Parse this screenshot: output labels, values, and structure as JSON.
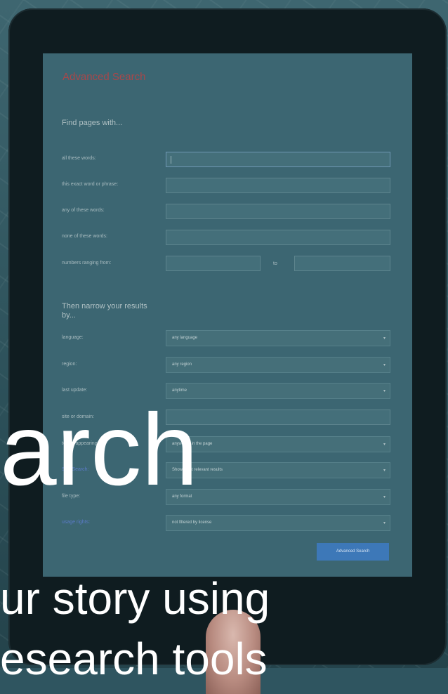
{
  "screen": {
    "title": "Advanced Search",
    "find_heading": "Find pages with...",
    "find_rows": [
      {
        "label": "all these words:"
      },
      {
        "label": "this exact word or phrase:"
      },
      {
        "label": "any of these words:"
      },
      {
        "label": "none of these words:"
      },
      {
        "label": "numbers ranging from:",
        "to": "to"
      }
    ],
    "narrow_heading": "Then narrow your results by...",
    "narrow_rows": [
      {
        "label": "language:",
        "value": "any language"
      },
      {
        "label": "region:",
        "value": "any region"
      },
      {
        "label": "last update:",
        "value": "anytime"
      },
      {
        "label": "site or domain:",
        "value": ""
      },
      {
        "label": "terms appearing:",
        "value": "anywhere in the page"
      },
      {
        "label": "SafeSearch:",
        "value": "Show most relevant results"
      },
      {
        "label": "file type:",
        "value": "any format"
      },
      {
        "label": "usage rights:",
        "value": "not filtered by license"
      }
    ],
    "button_label": "Advanced Search"
  },
  "overlay": {
    "big_word": "arch",
    "line1": "ur story using",
    "line2": "esearch tools"
  }
}
